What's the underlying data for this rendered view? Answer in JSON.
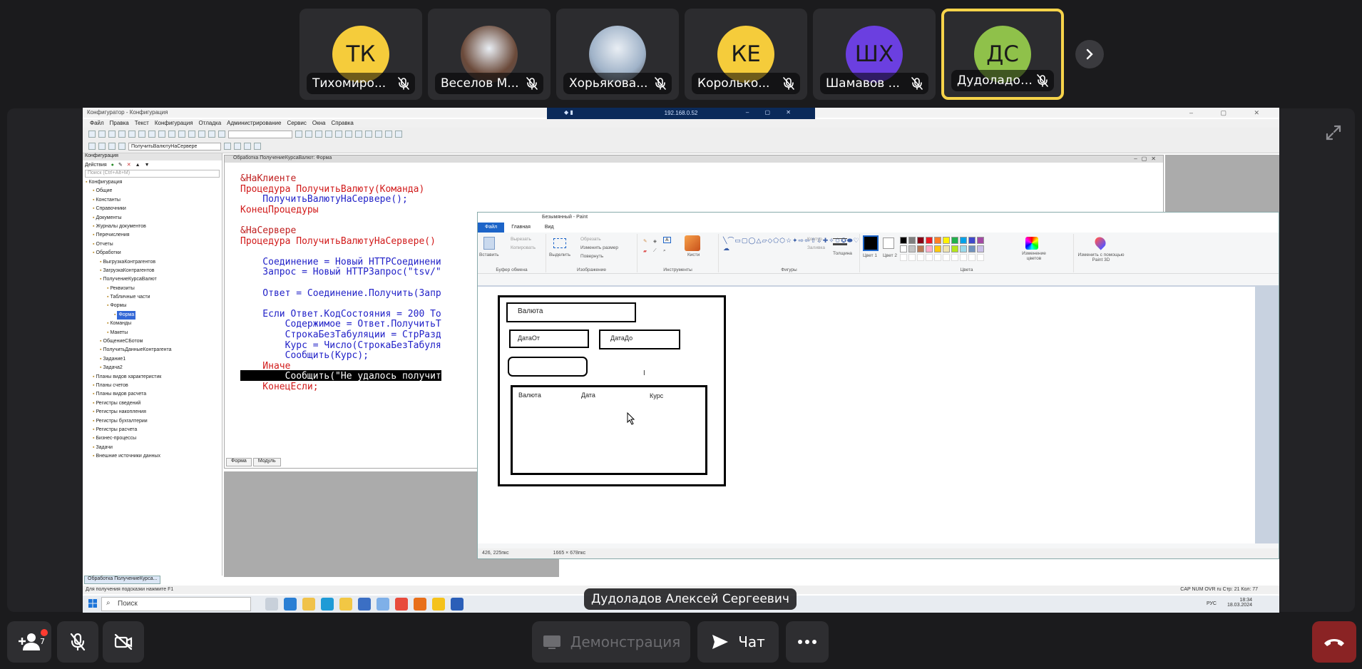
{
  "participants": [
    {
      "initials": "ТК",
      "name": "Тихомиро...",
      "color": "#f5cc3b",
      "photo": false
    },
    {
      "initials": "",
      "name": "Веселов М...",
      "color": "#6b4a3a",
      "photo": true
    },
    {
      "initials": "",
      "name": "Хорьякова...",
      "color": "#9fb2c8",
      "photo": true
    },
    {
      "initials": "КЕ",
      "name": "Королько...",
      "color": "#f5cc3b",
      "photo": false
    },
    {
      "initials": "ШХ",
      "name": "Шамавов ...",
      "color": "#6b3fe0",
      "photo": false
    },
    {
      "initials": "ДС",
      "name": "Дудоладов А...",
      "color": "#8fc14a",
      "photo": false
    }
  ],
  "speaker_name": "Дудоладов Алексей Сергеевич",
  "controls": {
    "participants_count": "7",
    "share_label": "Демонстрация",
    "chat_label": "Чат"
  },
  "screen": {
    "title": "Конфигуратор - Конфигурация",
    "rdp_address": "192.168.0.52",
    "menu": [
      "Файл",
      "Правка",
      "Текст",
      "Конфигурация",
      "Отладка",
      "Администрирование",
      "Сервис",
      "Окна",
      "Справка"
    ],
    "toolbar_combo": "ПолучитьВалютуНаСервере",
    "config_panel": {
      "title": "Конфигурация",
      "actions": "Действия",
      "search_placeholder": "Поиск (Ctrl+Alt+M)",
      "tree": [
        "Конфигурация",
        "Общие",
        "Константы",
        "Справочники",
        "Документы",
        "Журналы документов",
        "Перечисления",
        "Отчеты",
        "Обработки",
        "ВыгрузкаКонтрагентов",
        "ЗагрузкаКонтрагентов",
        "ПолучениеКурсаВалют",
        "Реквизиты",
        "Табличные части",
        "Формы",
        "Форма",
        "Команды",
        "Макеты",
        "ОбщениеСБотом",
        "ПолучитьДанныеКонтрагента",
        "Задание1",
        "Задача2",
        "Планы видов характеристик",
        "Планы счетов",
        "Планы видов расчета",
        "Регистры сведений",
        "Регистры накопления",
        "Регистры бухгалтерии",
        "Регистры расчета",
        "Бизнес-процессы",
        "Задачи",
        "Внешние источники данных"
      ]
    },
    "code_window": {
      "title": "Обработка ПолучениеКурсаВалют: Форма",
      "lines": [
        "&НаКлиенте",
        "Процедура ПолучитьВалюту(Команда)",
        "    ПолучитьВалютуНаСервере();",
        "КонецПроцедуры",
        "",
        "&НаСервере",
        "Процедура ПолучитьВалютуНаСервере()",
        "",
        "    Соединение = Новый HTTPСоединени",
        "    Запрос = Новый HTTPЗапрос(\"tsv/\"",
        "",
        "    Ответ = Соединение.Получить(Запр",
        "",
        "    Если Ответ.КодСостояния = 200 То",
        "        Содержимое = Ответ.ПолучитьТ",
        "        СтрокаБезТабуляции = СтрРазд",
        "        Курс = Число(СтрокаБезТабуля",
        "        Сообщить(Курс);",
        "    Иначе",
        "        Сообщить(\"Не удалось получит",
        "    КонецЕсли;"
      ],
      "tabs": [
        "Форма",
        "Модуль"
      ]
    },
    "paint": {
      "title": "Безымянный - Paint",
      "tabs": [
        "Файл",
        "Главная",
        "Вид"
      ],
      "groups": [
        "Буфер обмена",
        "Изображение",
        "Инструменты",
        "Фигуры",
        "Цвета"
      ],
      "clipboard": {
        "paste": "Вставить",
        "cut": "Вырезать",
        "copy": "Копировать"
      },
      "image": {
        "select": "Выделить",
        "crop": "Обрезать",
        "resize": "Изменить размер",
        "rotate": "Повернуть"
      },
      "shapes": {
        "outline": "Контур",
        "fill": "Заливка"
      },
      "brushes": "Кисти",
      "thickness": "Толщина",
      "color1": "Цвет 1",
      "color2": "Цвет 2",
      "edit_colors": "Изменение цветов",
      "paint3d": "Изменить с помощью Paint 3D",
      "drawing": {
        "field1": "Валюта",
        "field2": "ДатаОт",
        "field3": "ДатаДо",
        "table_cols": [
          "Валюта",
          "Дата",
          "Курс"
        ]
      },
      "status_pos": "426, 225пкс",
      "status_size": "1665 × 678пкс"
    },
    "status_hint": "Для получения подсказки нажмите F1",
    "window_chip": "Обработка ПолучениеКурса...",
    "status_right": "CAP  NUM  OVR  ru  Стр: 21   Кол: 77",
    "taskbar": {
      "search": "Поиск",
      "lang": "РУС",
      "time": "18:34",
      "date": "18.03.2024"
    }
  }
}
